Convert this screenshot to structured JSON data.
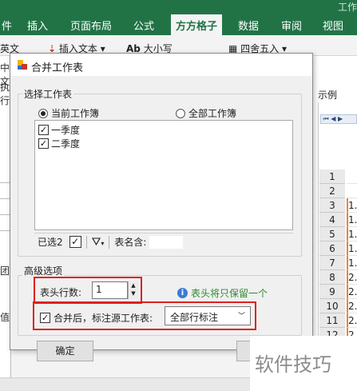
{
  "ribbon": {
    "tabs": [
      "件",
      "插入",
      "页面布局",
      "公式",
      "方方格子",
      "数据",
      "审阅",
      "视图"
    ],
    "active_tab": "方方格子",
    "title_fragment": "工作",
    "items": [
      "英文",
      "插入文本",
      "大小写",
      "四舍五入"
    ],
    "accent_color": "#217346"
  },
  "left_fragments": [
    "中文",
    "执行",
    "团",
    "值"
  ],
  "dialog": {
    "title": "合并工作表",
    "select_group_label": "选择工作表",
    "radio_current": "当前工作簿",
    "radio_all": "全部工作簿",
    "sheets": [
      {
        "label": "一季度",
        "checked": true
      },
      {
        "label": "二季度",
        "checked": true
      }
    ],
    "selected_count_label": "已选2",
    "sheet_name_label": "表名含:",
    "advanced_label": "高级选项",
    "header_rows_label": "表头行数:",
    "header_rows_value": "1",
    "header_note": "表头将只保留一个",
    "mark_source_label": "合并后，标注源工作表:",
    "mark_source_value": "全部行标注",
    "ok_label": "确定"
  },
  "preview": {
    "label": "示例",
    "row_numbers": [
      "1",
      "2",
      "3",
      "4",
      "5",
      "6",
      "7",
      "8",
      "9",
      "10",
      "11",
      "12"
    ],
    "cell_prefixes": [
      "",
      "",
      "1.",
      "1.",
      "1.",
      "1.",
      "1.",
      "2.",
      "2.",
      "2.",
      "2.",
      "2."
    ]
  },
  "watermark": "软件技巧"
}
